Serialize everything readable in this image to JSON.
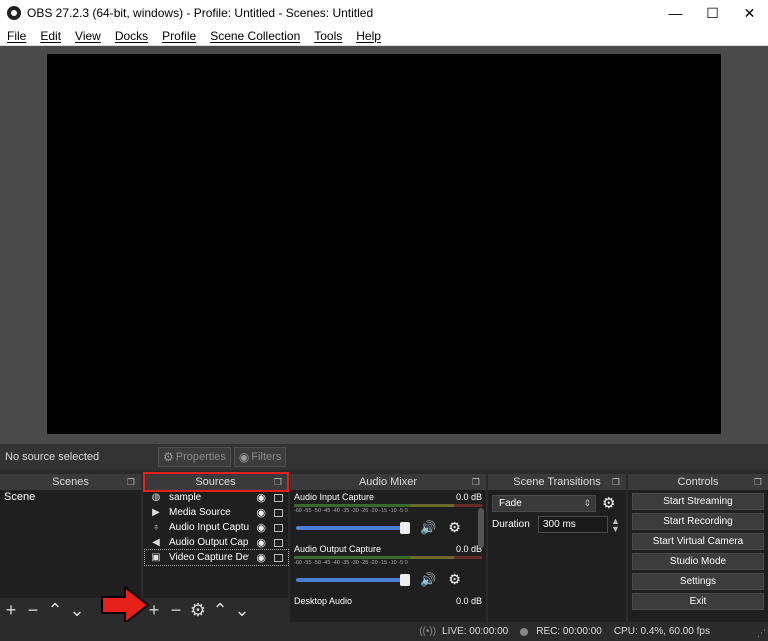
{
  "window": {
    "title": "OBS 27.2.3 (64-bit, windows) - Profile: Untitled - Scenes: Untitled",
    "minimize": "—",
    "maximize": "☐",
    "close": "✕"
  },
  "menu": [
    "File",
    "Edit",
    "View",
    "Docks",
    "Profile",
    "Scene Collection",
    "Tools",
    "Help"
  ],
  "source_bar": {
    "status": "No source selected",
    "properties": "Properties",
    "filters": "Filters"
  },
  "scenes": {
    "title": "Scenes",
    "items": [
      "Scene"
    ]
  },
  "sources": {
    "title": "Sources",
    "items": [
      {
        "name": "sample",
        "icon": "globe-icon"
      },
      {
        "name": "Media Source",
        "icon": "play-icon"
      },
      {
        "name": "Audio Input Captu",
        "icon": "microphone-icon"
      },
      {
        "name": "Audio Output Cap",
        "icon": "speaker-icon"
      },
      {
        "name": "Video Capture Dev",
        "icon": "camera-icon"
      }
    ]
  },
  "mixer": {
    "title": "Audio Mixer",
    "tick_labels": "-60 -55 -50 -45 -40 -35 -30 -25 -20 -15 -10 -5 0",
    "channels": [
      {
        "name": "Audio Input Capture",
        "db": "0.0 dB"
      },
      {
        "name": "Audio Output Capture",
        "db": "0.0 dB"
      },
      {
        "name": "Desktop Audio",
        "db": "0.0 dB"
      }
    ]
  },
  "transitions": {
    "title": "Scene Transitions",
    "selected": "Fade",
    "duration_label": "Duration",
    "duration_value": "300 ms"
  },
  "controls": {
    "title": "Controls",
    "buttons": [
      "Start Streaming",
      "Start Recording",
      "Start Virtual Camera",
      "Studio Mode",
      "Settings",
      "Exit"
    ]
  },
  "status": {
    "live": "LIVE: 00:00:00",
    "rec": "REC: 00:00:00",
    "cpu": "CPU: 0.4%, 60.00 fps"
  },
  "colors": {
    "highlight": "#e8201c",
    "slider": "#4b7fd6"
  }
}
